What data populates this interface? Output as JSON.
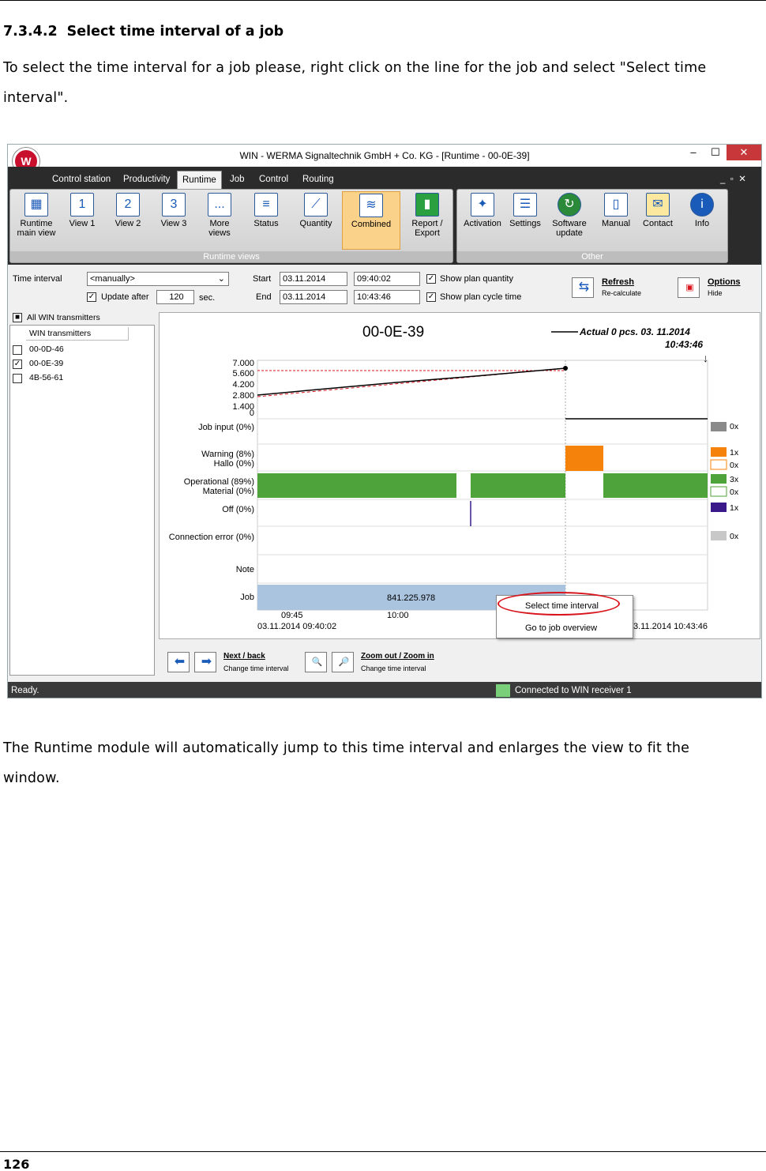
{
  "doc": {
    "heading_number": "7.3.4.2",
    "heading_text": "Select time interval of a job",
    "intro_line1": "To select the time interval for a job please, right click on the line for the job and select \"Select time",
    "intro_line2": "interval\".",
    "after_line1": "The Runtime module will automatically jump to this time interval and enlarges the view to fit the",
    "after_line2": "window.",
    "page_number": "126"
  },
  "window": {
    "title": "WIN - WERMA Signaltechnik GmbH + Co. KG - [Runtime - 00-0E-39]",
    "minimize": "–",
    "maximize": "☐",
    "close": "✕"
  },
  "tabs": [
    "Control station",
    "Productivity",
    "Runtime",
    "Job",
    "Control",
    "Routing"
  ],
  "ribbon": {
    "group1_label": "Runtime views",
    "group2_label": "Other",
    "buttons": [
      "Runtime main view",
      "View 1",
      "View 2",
      "View 3",
      "More views",
      "Status",
      "Quantity",
      "Combined",
      "Report / Export",
      "Activation",
      "Settings",
      "Software update",
      "Manual",
      "Contact",
      "Info"
    ],
    "icons": [
      "1",
      "2",
      "3",
      "..."
    ]
  },
  "controls": {
    "time_interval_label": "Time interval",
    "time_interval_value": "<manually>",
    "update_after_label": "Update after",
    "update_after_value": "120",
    "sec_label": "sec.",
    "start_label": "Start",
    "end_label": "End",
    "start_date": "03.11.2014",
    "start_time": "09:40:02",
    "end_date": "03.11.2014",
    "end_time": "10:43:46",
    "show_plan_quantity": "Show plan quantity",
    "show_plan_cycle": "Show plan cycle time",
    "refresh": "Refresh",
    "recalculate": "Re-calculate",
    "options": "Options",
    "hide": "Hide"
  },
  "transmitters": {
    "all": "All WIN transmitters",
    "header": "WIN transmitters",
    "items": [
      "00-0D-46",
      "00-0E-39",
      "4B-56-61"
    ]
  },
  "chart": {
    "title": "00-0E-39",
    "legend_actual": "Actual 0 pcs.  03. 11.2014",
    "legend_time": "10:43:46",
    "yticks": [
      "7.000",
      "5.600",
      "4.200",
      "2.800",
      "1.400",
      "0"
    ],
    "rows": [
      "Job input (0%)",
      "Warning (8%)",
      "Hallo (0%)",
      "Operational (89%)",
      "Material (0%)",
      "Off (0%)",
      "Connection error (0%)",
      "Note",
      "Job"
    ],
    "counts": [
      "0x",
      "1x",
      "0x",
      "3x",
      "0x",
      "1x",
      "0x"
    ],
    "job_value": "841.225.978",
    "xticks": [
      "09:45",
      "10:00"
    ],
    "start_label": "03.11.2014 09:40:02",
    "end_label": "3.11.2014 10:43:46"
  },
  "context_menu": {
    "item1": "Select time interval",
    "item2": "Go to job overview"
  },
  "nav": {
    "next_back": "Next / back",
    "change1": "Change time interval",
    "zoom": "Zoom out / Zoom in",
    "change2": "Change time interval"
  },
  "status": {
    "ready": "Ready.",
    "connected": "Connected to WIN receiver 1"
  },
  "colors": {
    "operational": "#4ea33a",
    "warning": "#f5820a",
    "off": "#3a1a8a",
    "job_bar": "#aac4e0",
    "grey": "#8a8a8a",
    "highlight": "#d8141c"
  }
}
